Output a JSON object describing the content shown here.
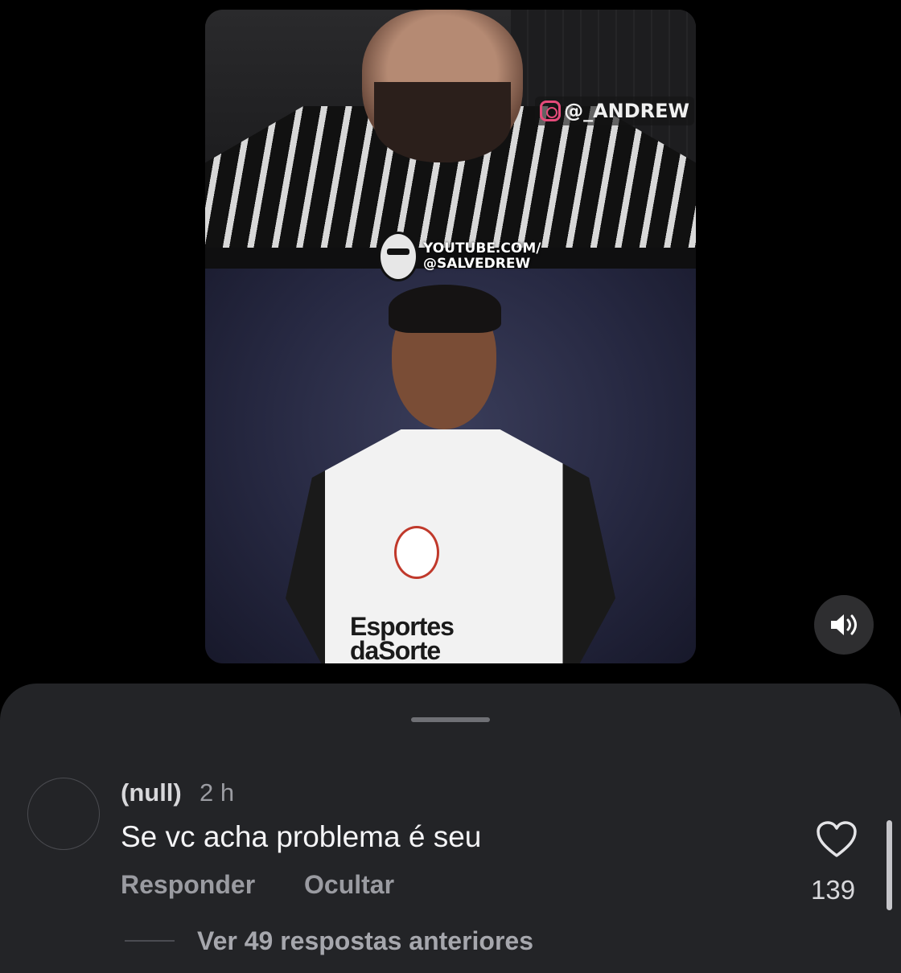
{
  "video": {
    "instagram_handle": "@_ANDREW",
    "watermark_line1": "YOUTUBE.COM/",
    "watermark_line2": "@SALVEDREW",
    "jersey_text": "Esportes daSorte",
    "volume_icon": "speaker-volume-icon"
  },
  "comment": {
    "username": "(null)",
    "time": "2 h",
    "text": "Se vc acha problema é seu",
    "reply_label": "Responder",
    "hide_label": "Ocultar",
    "like_icon": "heart-outline-icon",
    "like_count": "139",
    "view_replies_label": "Ver 49 respostas anteriores"
  },
  "colors": {
    "background": "#000000",
    "sheet": "#232427",
    "secondary_text": "#9a9ba1"
  }
}
